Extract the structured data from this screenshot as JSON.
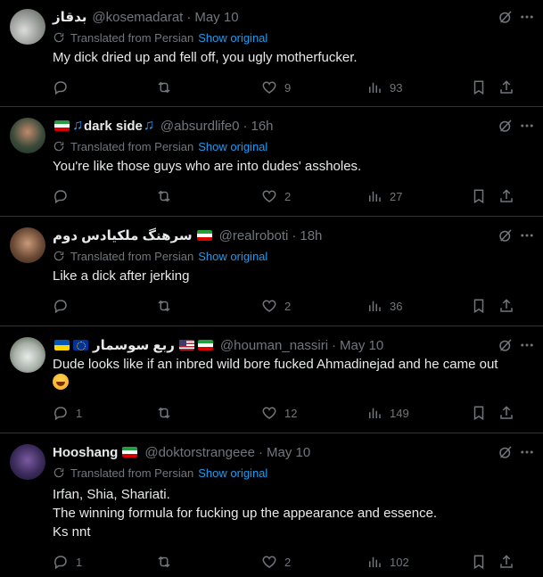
{
  "translated_label": "Translated from Persian",
  "show_original_label": "Show original",
  "tweets": [
    {
      "name": "بدقاز",
      "handle": "@kosemadarat",
      "time": "May 10",
      "translated": true,
      "text": "My dick dried up and fell off, you ugly motherfucker.",
      "replies": "",
      "likes": "9",
      "views": "93"
    },
    {
      "name": "dark side",
      "handle": "@absurdlife0",
      "time": "16h",
      "translated": true,
      "text": "You're like those guys who are into dudes' assholes.",
      "replies": "",
      "likes": "2",
      "views": "27"
    },
    {
      "name": "سرهنگ ملکیادس دوم",
      "handle": "@realroboti",
      "time": "18h",
      "translated": true,
      "text": "Like a dick after jerking",
      "replies": "",
      "likes": "2",
      "views": "36"
    },
    {
      "name": "ربع سوسمار",
      "handle": "@houman_nassiri",
      "time": "May 10",
      "translated": false,
      "text": "Dude looks like if an inbred wild bore fucked Ahmadinejad and he came out",
      "replies": "1",
      "likes": "12",
      "views": "149"
    },
    {
      "name": "Hooshang",
      "handle": "@doktorstrangeee",
      "time": "May 10",
      "translated": true,
      "text": "Irfan, Shia, Shariati.\nThe winning formula for fucking up the appearance and essence.\nKs nnt",
      "replies": "1",
      "likes": "2",
      "views": "102"
    }
  ]
}
